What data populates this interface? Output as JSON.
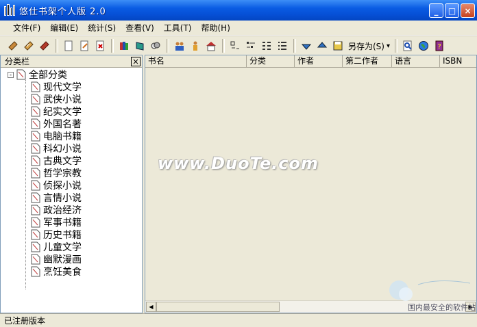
{
  "window": {
    "title": "悠仕书架个人版 2.0",
    "minimize": "_",
    "maximize": "□",
    "close": "×"
  },
  "menu": [
    "文件(F)",
    "编辑(E)",
    "统计(S)",
    "查看(V)",
    "工具(T)",
    "帮助(H)"
  ],
  "toolbar": {
    "save_as_label": "另存为(S)",
    "dropdown_arrow": "▾"
  },
  "panel": {
    "title": "分类栏",
    "close": "×"
  },
  "tree": {
    "expander": "-",
    "root": "全部分类",
    "children": [
      "现代文学",
      "武侠小说",
      "纪实文学",
      "外国名著",
      "电脑书籍",
      "科幻小说",
      "古典文学",
      "哲学宗教",
      "侦探小说",
      "言情小说",
      "政治经济",
      "军事书籍",
      "历史书籍",
      "儿童文学",
      "幽默漫画",
      "烹饪美食"
    ]
  },
  "columns": [
    "书名",
    "分类",
    "作者",
    "第二作者",
    "语言",
    "ISBN"
  ],
  "watermark": "www.DuoTe.com",
  "scroll": {
    "left": "◀",
    "right": "▶"
  },
  "status": "已注册版本",
  "corner_watermark": "国内最安全的软件站",
  "colors": {
    "titlebar": "#0a5ce3",
    "panel_border": "#7f9db9",
    "chrome": "#ece9d8"
  }
}
